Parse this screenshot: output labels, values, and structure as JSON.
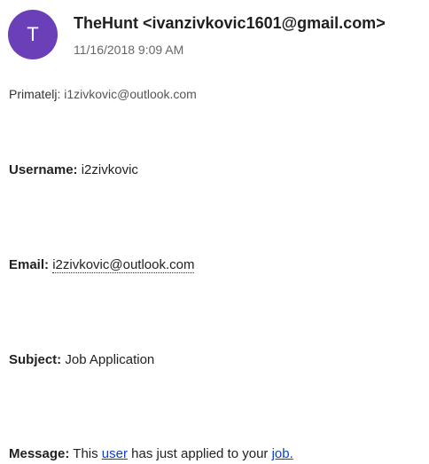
{
  "header": {
    "avatar_initial": "T",
    "sender_name": "TheHunt",
    "sender_email": "<ivanzivkovic1601@gmail.com>",
    "date": "11/16/2018 9:09 AM"
  },
  "recipient": {
    "label": "Primatelj:",
    "value": "i1zivkovic@outlook.com"
  },
  "body": {
    "username_label": "Username:",
    "username_value": "i2zivkovic",
    "email_label": "Email:",
    "email_value": "i2zivkovic@outlook.com",
    "subject_label": "Subject:",
    "subject_value": "Job Application",
    "message_label": "Message:",
    "message_prefix": "This",
    "message_link1": "user",
    "message_middle": "has just applied to your",
    "message_link2": "job."
  },
  "colors": {
    "avatar_bg": "#6b3fb8",
    "link": "#0a3fd1"
  }
}
